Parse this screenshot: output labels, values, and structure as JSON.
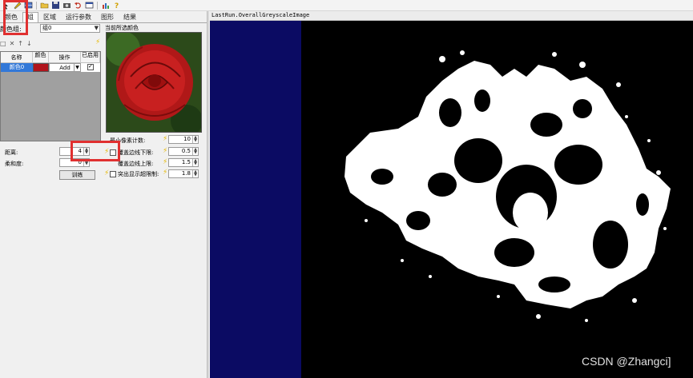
{
  "colors": {
    "accent_red": "#e03030",
    "selected_row": "#3278d8",
    "swatch": "#b0141c",
    "viewer_bg": "#000000",
    "navy": "#0b0b63"
  },
  "toolbar": {
    "icons": [
      "pointer-icon",
      "pencil-icon",
      "grid-icon",
      "open-folder-icon",
      "save-icon",
      "camera-icon",
      "undo-icon",
      "table-icon",
      "bar-chart-icon",
      "help-icon"
    ]
  },
  "tabs": [
    {
      "label": "颜色",
      "active": false
    },
    {
      "label": "组",
      "active": true
    },
    {
      "label": "区域",
      "active": false
    },
    {
      "label": "运行参数",
      "active": false
    },
    {
      "label": "图形",
      "active": false
    },
    {
      "label": "结果",
      "active": false
    }
  ],
  "color_group": {
    "label": "颜色组:",
    "selected": "组0"
  },
  "table": {
    "headers": [
      "名称",
      "颜色",
      "操作",
      "已启用"
    ],
    "rows": [
      {
        "name": "颜色0",
        "operation": "Add",
        "enabled": true
      }
    ]
  },
  "preview": {
    "title": "当前所选颜色"
  },
  "params_left": {
    "distance_label": "距离:",
    "distance_value": "4",
    "softness_label": "柔和度:",
    "softness_value": "0",
    "train_label": "训练"
  },
  "params_right": {
    "min_pixel_label": "最小像素计数:",
    "min_pixel_value": "10",
    "lower_label": "覆盖边线下限:",
    "lower_value": "0.5",
    "upper_label": "覆盖边线上限:",
    "upper_value": "1.5",
    "highlight_label": "突出显示超限制:",
    "highlight_value": "1.8"
  },
  "viewer": {
    "title": "LastRun.OverallGreyscaleImage"
  },
  "watermark": "CSDN @Zhangci]"
}
